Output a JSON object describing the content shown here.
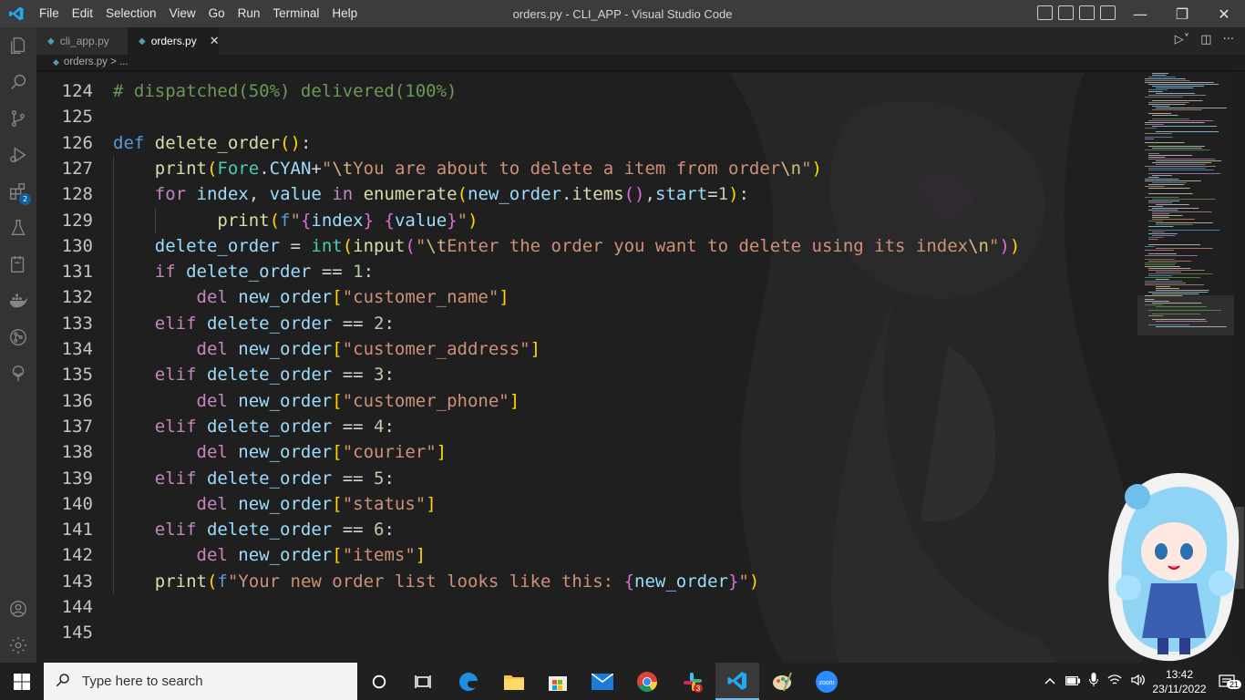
{
  "titlebar": {
    "menu": [
      "File",
      "Edit",
      "Selection",
      "View",
      "Go",
      "Run",
      "Terminal",
      "Help"
    ],
    "title": "orders.py - CLI_APP - Visual Studio Code"
  },
  "activitybar": {
    "items": [
      "explorer-icon",
      "search-icon",
      "source-control-icon",
      "run-debug-icon",
      "extensions-icon",
      "testing-icon",
      "remote-explorer-icon",
      "docker-icon",
      "gitlens-icon",
      "tree-icon"
    ],
    "extensions_badge": "2",
    "bottom": [
      "account-icon",
      "manage-gear-icon"
    ]
  },
  "tabs": [
    {
      "label": "cli_app.py",
      "active": false
    },
    {
      "label": "orders.py",
      "active": true
    }
  ],
  "breadcrumb": {
    "file": "orders.py",
    "rest": "> ..."
  },
  "editor": {
    "lines": [
      {
        "n": "124",
        "tokens": [
          [
            "com",
            "# dispatched(50%) delivered(100%)"
          ]
        ]
      },
      {
        "n": "125",
        "tokens": []
      },
      {
        "n": "126",
        "tokens": [
          [
            "kw",
            "def "
          ],
          [
            "fn",
            "delete_order"
          ],
          [
            "br1",
            "()"
          ],
          [
            "plain",
            ":"
          ]
        ]
      },
      {
        "n": "127",
        "tokens": [
          [
            "plain",
            "    "
          ],
          [
            "fn",
            "print"
          ],
          [
            "br1",
            "("
          ],
          [
            "cls",
            "Fore"
          ],
          [
            "plain",
            "."
          ],
          [
            "var",
            "CYAN"
          ],
          [
            "plain",
            "+"
          ],
          [
            "str",
            "\""
          ],
          [
            "esc",
            "\\t"
          ],
          [
            "str",
            "You are about to delete a item from order"
          ],
          [
            "esc",
            "\\n"
          ],
          [
            "str",
            "\""
          ],
          [
            "br1",
            ")"
          ]
        ]
      },
      {
        "n": "128",
        "tokens": [
          [
            "plain",
            "    "
          ],
          [
            "kw2",
            "for "
          ],
          [
            "var",
            "index"
          ],
          [
            "plain",
            ", "
          ],
          [
            "var",
            "value"
          ],
          [
            "kw2",
            " in "
          ],
          [
            "fn",
            "enumerate"
          ],
          [
            "br1",
            "("
          ],
          [
            "var",
            "new_order"
          ],
          [
            "plain",
            "."
          ],
          [
            "fn",
            "items"
          ],
          [
            "br2",
            "()"
          ],
          [
            "plain",
            ","
          ],
          [
            "var",
            "start"
          ],
          [
            "plain",
            "="
          ],
          [
            "num",
            "1"
          ],
          [
            "br1",
            ")"
          ],
          [
            "plain",
            ":"
          ]
        ]
      },
      {
        "n": "129",
        "tokens": [
          [
            "plain",
            "          "
          ],
          [
            "fn",
            "print"
          ],
          [
            "br1",
            "("
          ],
          [
            "kw",
            "f"
          ],
          [
            "str",
            "\""
          ],
          [
            "br2",
            "{"
          ],
          [
            "var",
            "index"
          ],
          [
            "br2",
            "}"
          ],
          [
            "str",
            " "
          ],
          [
            "br2",
            "{"
          ],
          [
            "var",
            "value"
          ],
          [
            "br2",
            "}"
          ],
          [
            "str",
            "\""
          ],
          [
            "br1",
            ")"
          ]
        ]
      },
      {
        "n": "130",
        "tokens": [
          [
            "plain",
            "    "
          ],
          [
            "var",
            "delete_order"
          ],
          [
            "plain",
            " = "
          ],
          [
            "cls",
            "int"
          ],
          [
            "br1",
            "("
          ],
          [
            "fn",
            "input"
          ],
          [
            "br2",
            "("
          ],
          [
            "str",
            "\""
          ],
          [
            "esc",
            "\\t"
          ],
          [
            "str",
            "Enter the order you want to delete using its index"
          ],
          [
            "esc",
            "\\n"
          ],
          [
            "str",
            "\""
          ],
          [
            "br2",
            ")"
          ],
          [
            "br1",
            ")"
          ]
        ]
      },
      {
        "n": "131",
        "tokens": [
          [
            "plain",
            "    "
          ],
          [
            "kw2",
            "if "
          ],
          [
            "var",
            "delete_order"
          ],
          [
            "plain",
            " == "
          ],
          [
            "num",
            "1"
          ],
          [
            "plain",
            ":"
          ]
        ]
      },
      {
        "n": "132",
        "tokens": [
          [
            "plain",
            "        "
          ],
          [
            "kw2",
            "del "
          ],
          [
            "var",
            "new_order"
          ],
          [
            "br1",
            "["
          ],
          [
            "str",
            "\"customer_name\""
          ],
          [
            "br1",
            "]"
          ]
        ]
      },
      {
        "n": "133",
        "tokens": [
          [
            "plain",
            "    "
          ],
          [
            "kw2",
            "elif "
          ],
          [
            "var",
            "delete_order"
          ],
          [
            "plain",
            " == "
          ],
          [
            "num",
            "2"
          ],
          [
            "plain",
            ":"
          ]
        ]
      },
      {
        "n": "134",
        "tokens": [
          [
            "plain",
            "        "
          ],
          [
            "kw2",
            "del "
          ],
          [
            "var",
            "new_order"
          ],
          [
            "br1",
            "["
          ],
          [
            "str",
            "\"customer_address\""
          ],
          [
            "br1",
            "]"
          ]
        ]
      },
      {
        "n": "135",
        "tokens": [
          [
            "plain",
            "    "
          ],
          [
            "kw2",
            "elif "
          ],
          [
            "var",
            "delete_order"
          ],
          [
            "plain",
            " == "
          ],
          [
            "num",
            "3"
          ],
          [
            "plain",
            ":"
          ]
        ]
      },
      {
        "n": "136",
        "tokens": [
          [
            "plain",
            "        "
          ],
          [
            "kw2",
            "del "
          ],
          [
            "var",
            "new_order"
          ],
          [
            "br1",
            "["
          ],
          [
            "str",
            "\"customer_phone\""
          ],
          [
            "br1",
            "]"
          ]
        ]
      },
      {
        "n": "137",
        "tokens": [
          [
            "plain",
            "    "
          ],
          [
            "kw2",
            "elif "
          ],
          [
            "var",
            "delete_order"
          ],
          [
            "plain",
            " == "
          ],
          [
            "num",
            "4"
          ],
          [
            "plain",
            ":"
          ]
        ]
      },
      {
        "n": "138",
        "tokens": [
          [
            "plain",
            "        "
          ],
          [
            "kw2",
            "del "
          ],
          [
            "var",
            "new_order"
          ],
          [
            "br1",
            "["
          ],
          [
            "str",
            "\"courier\""
          ],
          [
            "br1",
            "]"
          ]
        ]
      },
      {
        "n": "139",
        "tokens": [
          [
            "plain",
            "    "
          ],
          [
            "kw2",
            "elif "
          ],
          [
            "var",
            "delete_order"
          ],
          [
            "plain",
            " == "
          ],
          [
            "num",
            "5"
          ],
          [
            "plain",
            ":"
          ]
        ]
      },
      {
        "n": "140",
        "tokens": [
          [
            "plain",
            "        "
          ],
          [
            "kw2",
            "del "
          ],
          [
            "var",
            "new_order"
          ],
          [
            "br1",
            "["
          ],
          [
            "str",
            "\"status\""
          ],
          [
            "br1",
            "]"
          ]
        ]
      },
      {
        "n": "141",
        "tokens": [
          [
            "plain",
            "    "
          ],
          [
            "kw2",
            "elif "
          ],
          [
            "var",
            "delete_order"
          ],
          [
            "plain",
            " == "
          ],
          [
            "num",
            "6"
          ],
          [
            "plain",
            ":"
          ]
        ]
      },
      {
        "n": "142",
        "tokens": [
          [
            "plain",
            "        "
          ],
          [
            "kw2",
            "del "
          ],
          [
            "var",
            "new_order"
          ],
          [
            "br1",
            "["
          ],
          [
            "str",
            "\"items\""
          ],
          [
            "br1",
            "]"
          ]
        ]
      },
      {
        "n": "143",
        "tokens": [
          [
            "plain",
            "    "
          ],
          [
            "fn",
            "print"
          ],
          [
            "br1",
            "("
          ],
          [
            "kw",
            "f"
          ],
          [
            "str",
            "\"Your new order list looks like this: "
          ],
          [
            "br2",
            "{"
          ],
          [
            "var",
            "new_order"
          ],
          [
            "br2",
            "}"
          ],
          [
            "str",
            "\""
          ],
          [
            "br1",
            ")"
          ]
        ]
      },
      {
        "n": "144",
        "tokens": []
      },
      {
        "n": "145",
        "tokens": []
      }
    ]
  },
  "taskbar": {
    "search_placeholder": "Type here to search",
    "apps": [
      "task-view-icon",
      "widgets-icon",
      "edge-icon",
      "file-explorer-icon",
      "microsoft-store-icon",
      "mail-icon",
      "chrome-icon",
      "slack-icon",
      "vscode-icon",
      "paint-icon",
      "zoom-icon"
    ],
    "slack_badge": "3",
    "zoom_label": "zoom",
    "time": "13:42",
    "date": "23/11/2022",
    "notifications": "21"
  }
}
